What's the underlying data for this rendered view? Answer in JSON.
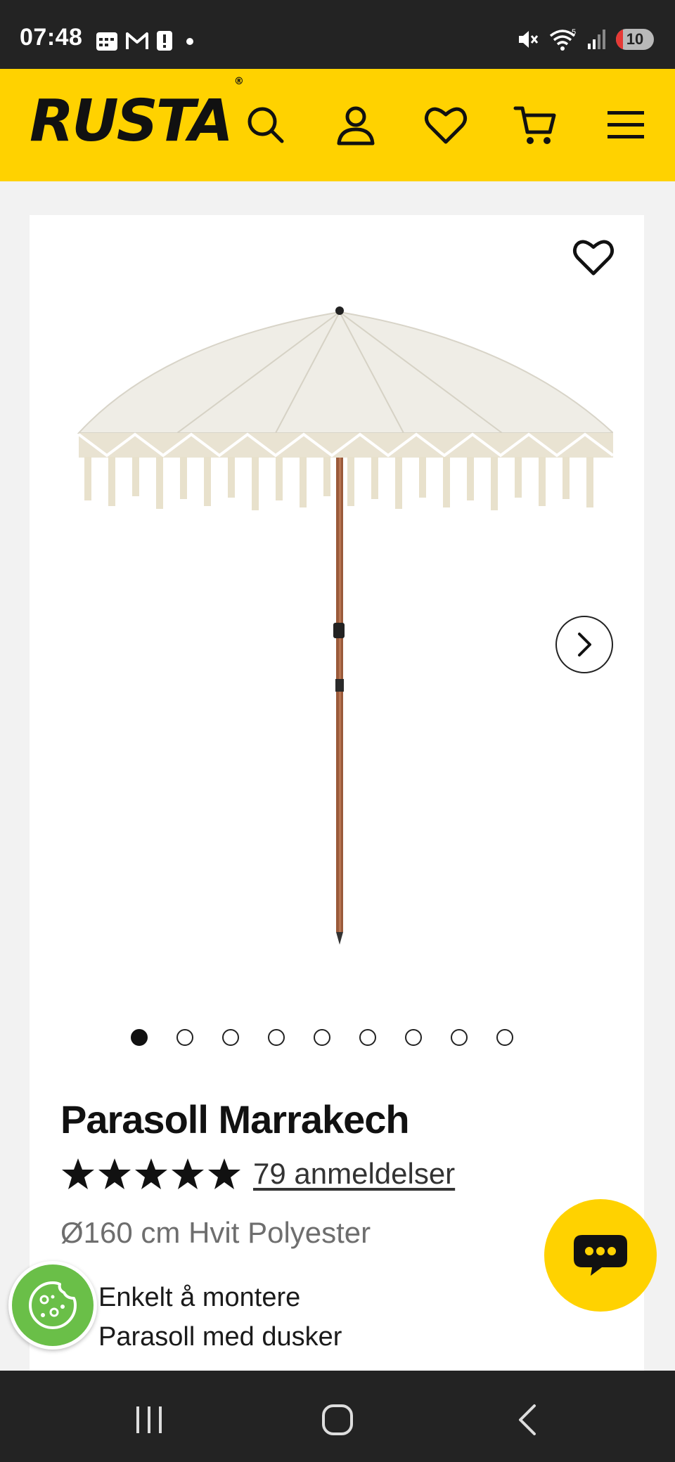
{
  "status_bar": {
    "time": "07:48",
    "notification_icons": [
      "calendar-icon",
      "gmail-icon",
      "alert-icon",
      "dot-icon"
    ],
    "system_icons": [
      "mute-icon",
      "wifi-icon",
      "signal-icon"
    ],
    "wifi_label": "5",
    "battery": "10"
  },
  "header": {
    "logo": "RUSTA",
    "logo_mark": "®",
    "icons": [
      "search-icon",
      "account-icon",
      "wishlist-icon",
      "cart-icon",
      "menu-icon"
    ],
    "background_color": "#ffd200"
  },
  "product": {
    "title": "Parasoll Marrakech",
    "rating_stars": 5,
    "rating_max": 5,
    "reviews_link": "79 anmeldelser",
    "variant": "Ø160 cm Hvit Polyester",
    "features": [
      "Enkelt å montere",
      "Parasoll med dusker"
    ],
    "image_count": 9,
    "active_image": 1
  },
  "floating": {
    "chat_icon": "chat-bubble-icon",
    "cookie_icon": "cookie-icon",
    "chat_color": "#ffd200",
    "cookie_color": "#6abf48"
  },
  "navbar": {
    "buttons": [
      "recent-apps-icon",
      "home-icon",
      "back-icon"
    ]
  }
}
